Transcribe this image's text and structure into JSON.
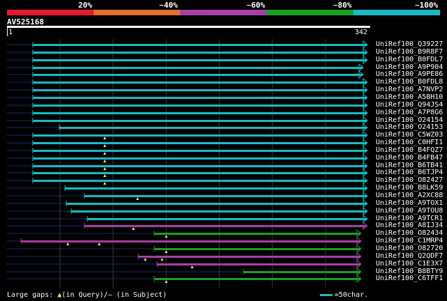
{
  "legend": {
    "labels": [
      "20%",
      "~40%",
      "~60%",
      "~80%",
      "~100%"
    ],
    "colors": [
      "#e8192c",
      "#e0702b",
      "#a63fa7",
      "#16a026",
      "#17bcc4"
    ]
  },
  "query": {
    "name": "AV525168",
    "start": "1",
    "end": "342"
  },
  "hits": [
    {
      "name": "UniRef100_Q39227",
      "color": "#17bcc4",
      "start": 47,
      "end": 525,
      "arrow": "triangle",
      "gaps": []
    },
    {
      "name": "UniRef100_B9R8F7",
      "color": "#17bcc4",
      "start": 47,
      "end": 525,
      "arrow": "triangle",
      "gaps": []
    },
    {
      "name": "UniRef100_B0FDL7",
      "color": "#17bcc4",
      "start": 47,
      "end": 525,
      "arrow": "triangle",
      "gaps": []
    },
    {
      "name": "UniRef100_A9P904",
      "color": "#17bcc4",
      "start": 47,
      "end": 519,
      "arrow": "triangle",
      "gaps": []
    },
    {
      "name": "UniRef100_A9PE86",
      "color": "#17bcc4",
      "start": 47,
      "end": 519,
      "arrow": "triangle",
      "gaps": []
    },
    {
      "name": "UniRef100_B0FDL8",
      "color": "#17bcc4",
      "start": 47,
      "end": 525,
      "arrow": "triangle",
      "gaps": []
    },
    {
      "name": "UniRef100_A7NVP2",
      "color": "#17bcc4",
      "start": 47,
      "end": 525,
      "arrow": "triangle",
      "gaps": []
    },
    {
      "name": "UniRef100_A5BH10",
      "color": "#17bcc4",
      "start": 47,
      "end": 525,
      "arrow": "triangle",
      "gaps": []
    },
    {
      "name": "UniRef100_Q94JS4",
      "color": "#17bcc4",
      "start": 47,
      "end": 525,
      "arrow": "triangle",
      "gaps": []
    },
    {
      "name": "UniRef100_A7P8G6",
      "color": "#17bcc4",
      "start": 47,
      "end": 525,
      "arrow": "triangle",
      "gaps": []
    },
    {
      "name": "UniRef100_O24154",
      "color": "#17bcc4",
      "start": 47,
      "end": 525,
      "arrow": "triangle",
      "gaps": []
    },
    {
      "name": "UniRef100_O24153",
      "color": "#17bcc4",
      "start": 85,
      "end": 525,
      "arrow": "triangle",
      "gaps": []
    },
    {
      "name": "UniRef100_C5WZ03",
      "color": "#17bcc4",
      "start": 47,
      "end": 525,
      "arrow": "triangle",
      "gaps": [
        150
      ]
    },
    {
      "name": "UniRef100_C0HFI1",
      "color": "#17bcc4",
      "start": 47,
      "end": 525,
      "arrow": "triangle",
      "gaps": [
        150
      ]
    },
    {
      "name": "UniRef100_B4FQZ7",
      "color": "#17bcc4",
      "start": 47,
      "end": 525,
      "arrow": "triangle",
      "gaps": [
        150
      ]
    },
    {
      "name": "UniRef100_B4FB47",
      "color": "#17bcc4",
      "start": 47,
      "end": 525,
      "arrow": "triangle",
      "gaps": [
        150
      ]
    },
    {
      "name": "UniRef100_B6TB41",
      "color": "#17bcc4",
      "start": 47,
      "end": 525,
      "arrow": "triangle",
      "gaps": [
        150
      ]
    },
    {
      "name": "UniRef100_B6TJP4",
      "color": "#17bcc4",
      "start": 47,
      "end": 525,
      "arrow": "triangle",
      "gaps": [
        150
      ]
    },
    {
      "name": "UniRef100_O82427",
      "color": "#17bcc4",
      "start": 47,
      "end": 525,
      "arrow": "triangle",
      "gaps": [
        150
      ]
    },
    {
      "name": "UniRef100_B8LK59",
      "color": "#17bcc4",
      "start": 93,
      "end": 525,
      "arrow": "triangle",
      "gaps": []
    },
    {
      "name": "UniRef100_A2XC88",
      "color": "#17bcc4",
      "start": 121,
      "end": 525,
      "arrow": "triangle",
      "gaps": [
        197
      ]
    },
    {
      "name": "UniRef100_A9TOX1",
      "color": "#17bcc4",
      "start": 95,
      "end": 525,
      "arrow": "triangle",
      "gaps": []
    },
    {
      "name": "UniRef100_A9TOU8",
      "color": "#17bcc4",
      "start": 102,
      "end": 525,
      "arrow": "triangle",
      "gaps": []
    },
    {
      "name": "UniRef100_A9TCR1",
      "color": "#17bcc4",
      "start": 125,
      "end": 525,
      "arrow": "triangle",
      "gaps": []
    },
    {
      "name": "UniRef100_A8IJ34",
      "color": "#a63fa7",
      "start": 121,
      "end": 525,
      "arrow": "triangle",
      "gaps": [
        191
      ]
    },
    {
      "name": "UniRef100_O82434",
      "color": "#16a026",
      "start": 221,
      "end": 516,
      "arrow": "triangle",
      "gaps": [
        238
      ]
    },
    {
      "name": "UniRef100_C1MRP4",
      "color": "#a63fa7",
      "start": 30,
      "end": 516,
      "arrow": "triangle",
      "gaps": [
        97,
        142
      ]
    },
    {
      "name": "UniRef100_O82720",
      "color": "#16a026",
      "start": 221,
      "end": 516,
      "arrow": "triangle",
      "gaps": [
        238
      ]
    },
    {
      "name": "UniRef100_Q2QDF7",
      "color": "#a63fa7",
      "start": 198,
      "end": 516,
      "arrow": "triangle",
      "gaps": [
        208,
        232
      ]
    },
    {
      "name": "UniRef100_C1E3X7",
      "color": "#a63fa7",
      "start": 225,
      "end": 516,
      "arrow": "triangle",
      "gaps": [
        275
      ]
    },
    {
      "name": "UniRef100_B8BTY9",
      "color": "#16a026",
      "start": 349,
      "end": 516,
      "arrow": "triangle",
      "gaps": []
    },
    {
      "name": "UniRef100_C6TFF1",
      "color": "#16a026",
      "start": 221,
      "end": 516,
      "arrow": "triangle",
      "gaps": [
        238
      ]
    }
  ],
  "footer": {
    "gaps_label": "Large gaps: ",
    "in_query": "(in Query)/",
    "in_subject": "– (in Subject)",
    "scale": "=50char."
  }
}
